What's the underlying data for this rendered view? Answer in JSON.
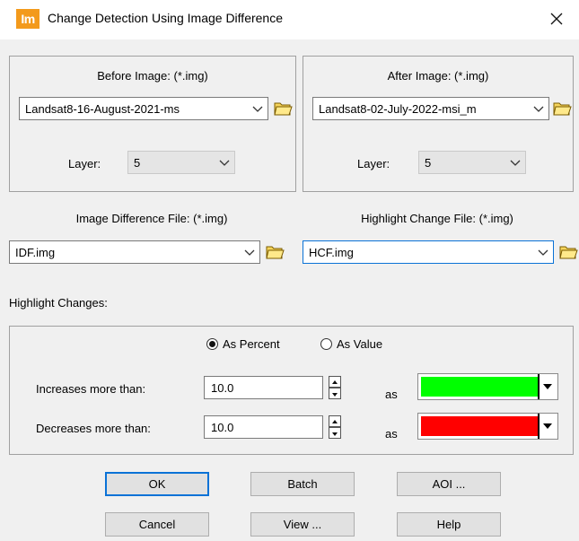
{
  "window": {
    "app_icon_text": "Im",
    "title": "Change Detection Using Image Difference"
  },
  "before": {
    "label": "Before Image: (*.img)",
    "file": "Landsat8-16-August-2021-ms",
    "layer_label": "Layer:",
    "layer_value": "5"
  },
  "after": {
    "label": "After Image: (*.img)",
    "file": "Landsat8-02-July-2022-msi_m",
    "layer_label": "Layer:",
    "layer_value": "5"
  },
  "outputs": {
    "idf_label": "Image Difference File: (*.img)",
    "idf_value": "IDF.img",
    "hcf_label": "Highlight Change File: (*.img)",
    "hcf_value": "HCF.img"
  },
  "highlight": {
    "title": "Highlight Changes:",
    "radio_percent": "As Percent",
    "radio_value": "As Value",
    "selected": "As Percent",
    "increase_label": "Increases more than:",
    "increase_value": "10.0",
    "decrease_label": "Decreases more than:",
    "decrease_value": "10.0",
    "as_label": "as",
    "increase_color": "#00ff00",
    "decrease_color": "#ff0000"
  },
  "buttons": {
    "ok": "OK",
    "batch": "Batch",
    "aoi": "AOI ...",
    "cancel": "Cancel",
    "view": "View ...",
    "help": "Help"
  }
}
